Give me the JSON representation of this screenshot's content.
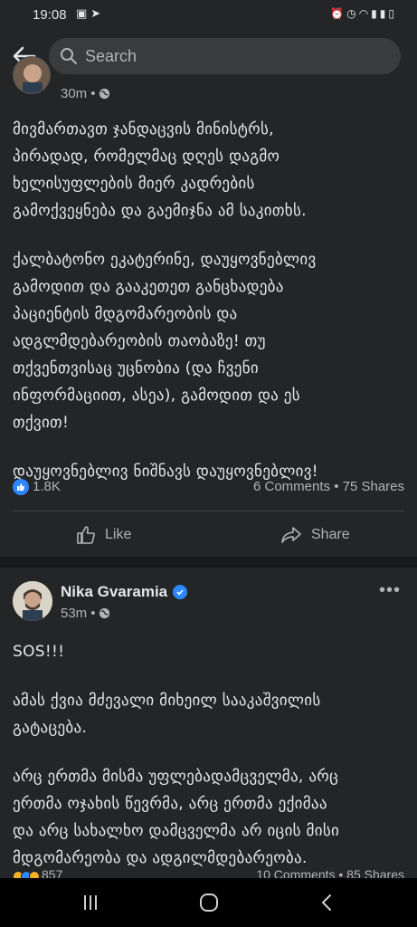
{
  "status_bar": {
    "time": "19:08",
    "left_icons": [
      "image-icon",
      "telegram-icon"
    ],
    "right_icons": [
      "alarm-icon",
      "clock-icon",
      "wifi-icon",
      "signal-icon",
      "signal-icon",
      "battery-icon"
    ]
  },
  "header": {
    "search_placeholder": "Search"
  },
  "post1": {
    "time": "30m",
    "privacy_icon": "globe-icon",
    "paragraphs": [
      "მივმართავთ ჯანდაცვის მინისტრს,\nპირადად, რომელმაც დღეს დაგმო\nხელისუფლების მიერ კადრების\nგამოქვეყნება და გაემიჯნა ამ საკითხს.",
      "ქალბატონო ეკატერინე, დაუყოვნებლივ\nგამოდით და გააკეთეთ განცხადება\nპაციენტის მდგომარეობის და\nადგლმდებარეობის თაობაზე! თუ\nთქვენთვისაც უცნობია (და ჩვენი\nინფორმაციით, ასეა), გამოდით და ეს\nთქვით!",
      "დაუყოვნებლივ ნიშნავს დაუყოვნებლივ!"
    ],
    "reactions_count": "1.8K",
    "comments_shares": "6 Comments • 75 Shares",
    "like_label": "Like",
    "share_label": "Share"
  },
  "post2": {
    "author": "Nika Gvaramia",
    "time": "53m",
    "privacy_icon": "globe-icon",
    "paragraphs": [
      "SOS!!!",
      "ამას ქვია მძევალი მიხეილ სააკაშვილის\nგატაცება.",
      "არც ერთმა მისმა უფლებადამცველმა, არც\nერთმა ოჯახის წევრმა, არც ერთმა ექიმაა\nდა არც სახალხო დამცველმა არ იცის მისი\nმდგომარეობა და ადგილმდებარეობა."
    ],
    "reactions_count": "857",
    "comments_shares": "10 Comments • 85 Shares"
  },
  "colors": {
    "background": "#18191a",
    "card": "#242526",
    "text_primary": "#e4e6eb",
    "text_secondary": "#b0b3b8",
    "accent": "#2d88ff"
  }
}
